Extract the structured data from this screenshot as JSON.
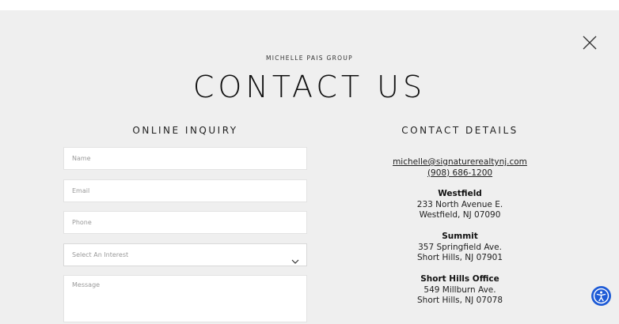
{
  "brand": "MICHELLE PAIS GROUP",
  "title": "CONTACT US",
  "inquiry": {
    "heading": "ONLINE INQUIRY",
    "name_placeholder": "Name",
    "email_placeholder": "Email",
    "phone_placeholder": "Phone",
    "interest_placeholder": "Select An Interest",
    "message_placeholder": "Message"
  },
  "details": {
    "heading": "CONTACT DETAILS",
    "email": "michelle@signaturerealtynj.com",
    "phone": "(908) 686-1200",
    "offices": [
      {
        "name": "Westfield",
        "line1": "233 North Avenue E.",
        "line2": "Westfield, NJ 07090"
      },
      {
        "name": "Summit",
        "line1": "357 Springfield Ave.",
        "line2": "Short Hills, NJ 07901"
      },
      {
        "name": "Short Hills Office",
        "line1": "549 Millburn Ave.",
        "line2": "Short Hills, NJ 07078"
      }
    ]
  },
  "icons": {
    "close": "close-icon",
    "chevron": "chevron-down-icon",
    "accessibility": "accessibility-icon"
  },
  "colors": {
    "modal_background": "#efefef",
    "accessibility_button": "#1e5bd6"
  }
}
